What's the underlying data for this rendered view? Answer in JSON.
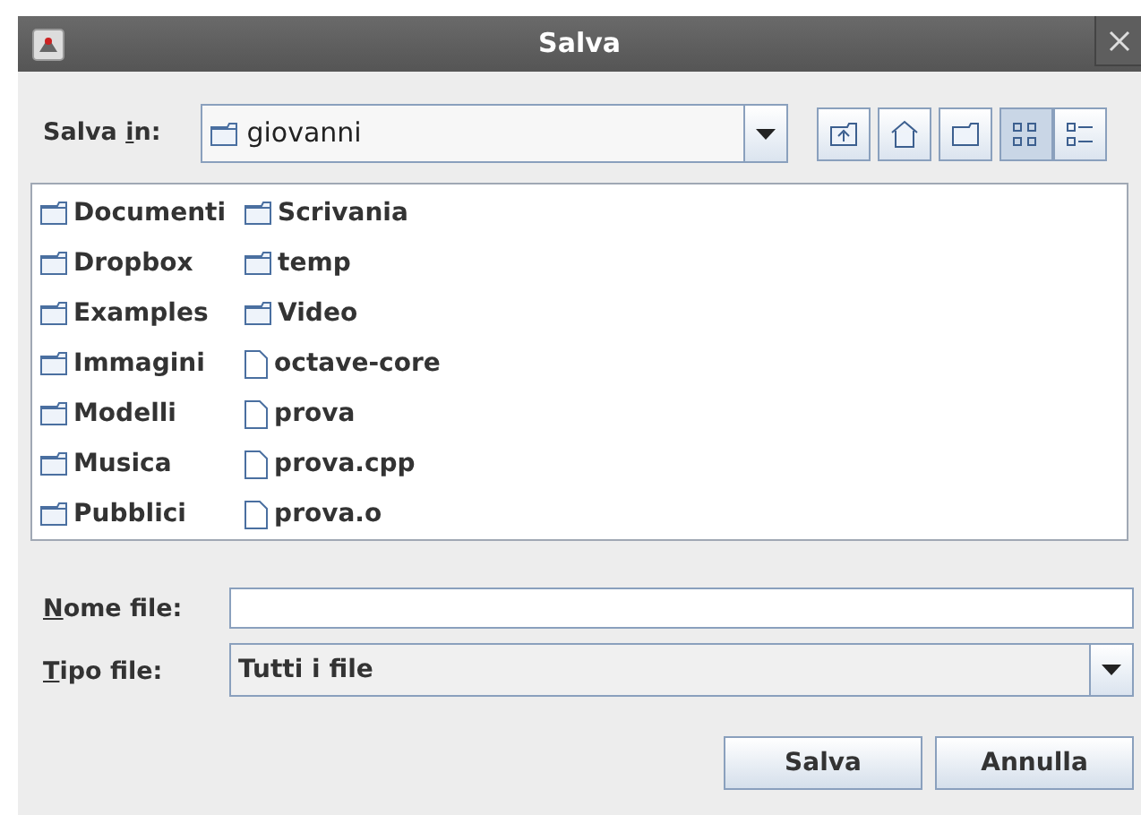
{
  "window": {
    "title": "Salva"
  },
  "look_in": {
    "label": {
      "before": "Salva ",
      "key": "i",
      "after": "n:"
    },
    "value": "giovanni"
  },
  "view_buttons": [
    {
      "kind": "up"
    },
    {
      "kind": "home"
    },
    {
      "kind": "new-folder"
    },
    {
      "kind": "list",
      "selected": true
    },
    {
      "kind": "details",
      "selected": false
    }
  ],
  "files": [
    {
      "name": "Documenti",
      "kind": "folder"
    },
    {
      "name": "Dropbox",
      "kind": "folder"
    },
    {
      "name": "Examples",
      "kind": "folder"
    },
    {
      "name": "Immagini",
      "kind": "folder"
    },
    {
      "name": "Modelli",
      "kind": "folder"
    },
    {
      "name": "Musica",
      "kind": "folder"
    },
    {
      "name": "Pubblici",
      "kind": "folder"
    },
    {
      "name": "Scrivania",
      "kind": "folder"
    },
    {
      "name": "temp",
      "kind": "folder"
    },
    {
      "name": "Video",
      "kind": "folder"
    },
    {
      "name": "octave-core",
      "kind": "file"
    },
    {
      "name": "prova",
      "kind": "file"
    },
    {
      "name": "prova.cpp",
      "kind": "file"
    },
    {
      "name": "prova.o",
      "kind": "file"
    }
  ],
  "file_name": {
    "label": {
      "key": "N",
      "after": "ome file:"
    }
  },
  "file_type": {
    "label": {
      "key": "T",
      "after": "ipo file:"
    },
    "value": "Tutti i file"
  },
  "buttons": [
    "Salva",
    "Annulla"
  ]
}
